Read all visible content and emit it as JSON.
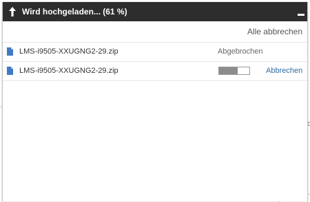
{
  "dialog": {
    "title": "Wird hochgeladen... (61 %)",
    "cancel_all_label": "Alle abbrechen",
    "colors": {
      "title_bar": "#2d2d2d",
      "link": "#2b6ca3",
      "progress_fill": "#8c8c8c"
    },
    "icons": {
      "title": "upload-arrow-icon",
      "minimize": "minimize-icon",
      "file": "file-icon"
    },
    "files": [
      {
        "name": "LMS-i9505-XXUGNG2-29.zip",
        "status": "Abgebrochen"
      },
      {
        "name": "LMS-i9505-XXUGNG2-29.zip",
        "progress": 0.61,
        "cancel_label": "Abbrechen"
      }
    ]
  }
}
